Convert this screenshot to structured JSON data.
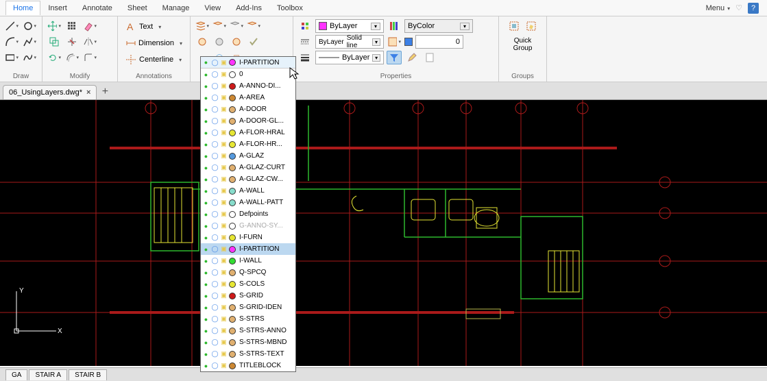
{
  "ribbon": {
    "tabs": [
      "Home",
      "Insert",
      "Annotate",
      "Sheet",
      "Manage",
      "View",
      "Add-Ins",
      "Toolbox"
    ],
    "active": "Home",
    "menu_label": "Menu"
  },
  "groups": {
    "draw": "Draw",
    "modify": "Modify",
    "annotations": "Annotations",
    "properties": "Properties",
    "groups": "Groups"
  },
  "annotations": {
    "text": "Text",
    "dimension": "Dimension",
    "centerline": "Centerline"
  },
  "layer_selected": {
    "name": "I-PARTITION",
    "color": "#ff33ff"
  },
  "properties": {
    "color": "ByLayer",
    "linestyle_left": "ByLayer",
    "linestyle_right": "Solid line",
    "lineweight": "ByLayer",
    "filter": "ByColor",
    "thickness": "0"
  },
  "quick_group": {
    "line1": "Quick",
    "line2": "Group"
  },
  "doc_tab": "06_UsingLayers.dwg*",
  "sheets": [
    "GA",
    "STAIR A",
    "STAIR B"
  ],
  "axis": {
    "x": "X",
    "y": "Y"
  },
  "layers": [
    {
      "name": "I-PARTITION",
      "color": "#ff33ff",
      "header": true
    },
    {
      "name": "0",
      "color": "#ffffff"
    },
    {
      "name": "A-ANNO-DI...",
      "color": "#cc1a1a"
    },
    {
      "name": "A-AREA",
      "color": "#cc8833"
    },
    {
      "name": "A-DOOR",
      "color": "#e0b070"
    },
    {
      "name": "A-DOOR-GL...",
      "color": "#e0b070"
    },
    {
      "name": "A-FLOR-HRAL",
      "color": "#e6e633"
    },
    {
      "name": "A-FLOR-HR...",
      "color": "#e6e633"
    },
    {
      "name": "A-GLAZ",
      "color": "#5599dd"
    },
    {
      "name": "A-GLAZ-CURT",
      "color": "#e0b070"
    },
    {
      "name": "A-GLAZ-CW...",
      "color": "#e0b070"
    },
    {
      "name": "A-WALL",
      "color": "#88ddcc"
    },
    {
      "name": "A-WALL-PATT",
      "color": "#88ddcc"
    },
    {
      "name": "Defpoints",
      "color": "#ffffff"
    },
    {
      "name": "G-ANNO-SY...",
      "color": "#ffffff",
      "dim": true
    },
    {
      "name": "I-FURN",
      "color": "#e6e633"
    },
    {
      "name": "I-PARTITION",
      "color": "#ff33ff",
      "sel": true
    },
    {
      "name": "I-WALL",
      "color": "#33dd33"
    },
    {
      "name": "Q-SPCQ",
      "color": "#e0b070"
    },
    {
      "name": "S-COLS",
      "color": "#e6e633"
    },
    {
      "name": "S-GRID",
      "color": "#cc1a1a"
    },
    {
      "name": "S-GRID-IDEN",
      "color": "#e0b070"
    },
    {
      "name": "S-STRS",
      "color": "#e0b070"
    },
    {
      "name": "S-STRS-ANNO",
      "color": "#e0b070"
    },
    {
      "name": "S-STRS-MBND",
      "color": "#e0b070"
    },
    {
      "name": "S-STRS-TEXT",
      "color": "#e0b070"
    },
    {
      "name": "TITLEBLOCK",
      "color": "#cc8833"
    }
  ]
}
